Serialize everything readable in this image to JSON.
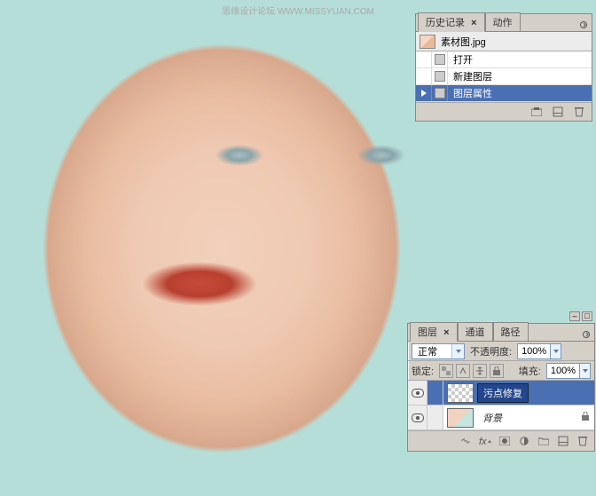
{
  "watermark": "思缘设计论坛  WWW.MISSYUAN.COM",
  "history": {
    "tabs": {
      "history": "历史记录",
      "actions": "动作"
    },
    "docName": "素材图.jpg",
    "items": [
      {
        "label": "打开"
      },
      {
        "label": "新建图层"
      },
      {
        "label": "图层属性"
      }
    ]
  },
  "layers": {
    "tabs": {
      "layers": "图层",
      "channels": "通道",
      "paths": "路径"
    },
    "blendMode": "正常",
    "opacityLabel": "不透明度:",
    "opacityValue": "100%",
    "lockLabel": "锁定:",
    "fillLabel": "填充:",
    "fillValue": "100%",
    "rows": [
      {
        "name": "污点修复"
      },
      {
        "name": "背景"
      }
    ]
  }
}
